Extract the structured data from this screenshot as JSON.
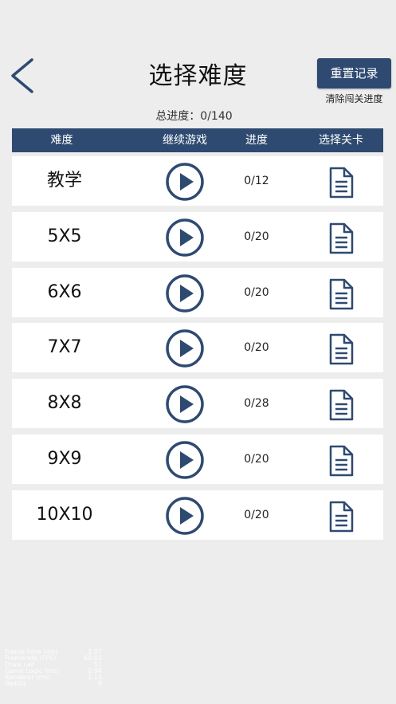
{
  "header": {
    "title": "选择难度",
    "reset_label": "重置记录",
    "reset_note": "清除闯关进度",
    "total_progress": "总进度：0/140",
    "back_icon": "chevron-left-icon"
  },
  "table": {
    "columns": [
      "难度",
      "继续游戏",
      "进度",
      "选择关卡"
    ],
    "rows": [
      {
        "name": "教学",
        "progress": "0/12"
      },
      {
        "name": "5X5",
        "progress": "0/20"
      },
      {
        "name": "6X6",
        "progress": "0/20"
      },
      {
        "name": "7X7",
        "progress": "0/20"
      },
      {
        "name": "8X8",
        "progress": "0/28"
      },
      {
        "name": "9X9",
        "progress": "0/20"
      },
      {
        "name": "10X10",
        "progress": "0/20"
      }
    ],
    "play_icon": "play-circle-icon",
    "select_icon": "document-icon"
  },
  "debug": [
    {
      "label": "Frame time (ms)",
      "value": "2.07"
    },
    {
      "label": "Framerate (FPS)",
      "value": "60.01"
    },
    {
      "label": "Draw call",
      "value": "51"
    },
    {
      "label": "Game Logic (ms)",
      "value": "0.94"
    },
    {
      "label": "Renderer (ms)",
      "value": "1.13"
    },
    {
      "label": "WebGL",
      "value": "9"
    }
  ],
  "colors": {
    "accent": "#2f4a71",
    "background": "#ededed",
    "row": "#ffffff"
  }
}
